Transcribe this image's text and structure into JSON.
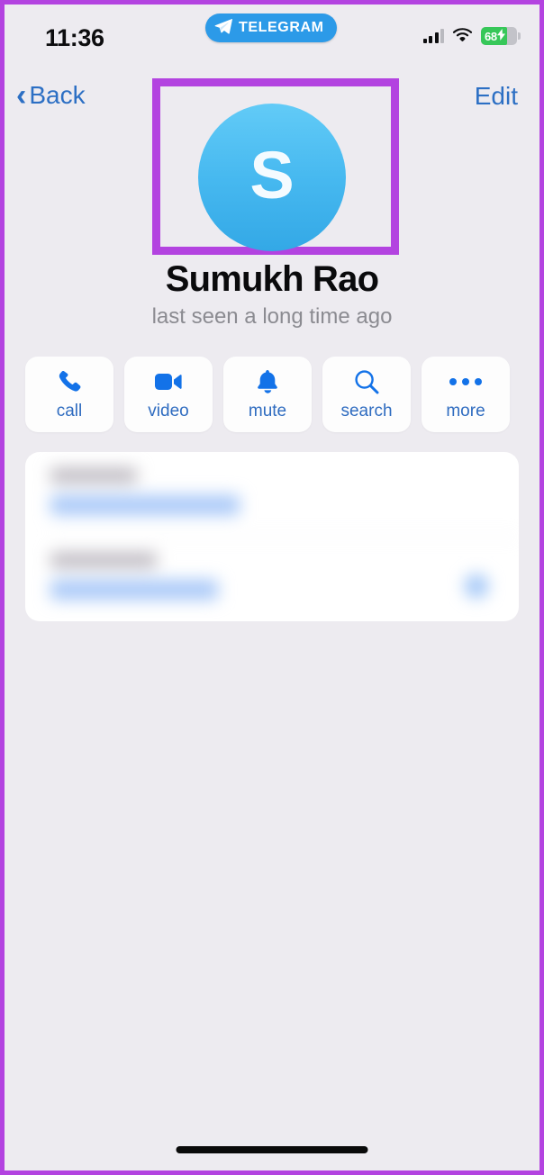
{
  "status_bar": {
    "time": "11:36",
    "app_pill": {
      "label": "TELEGRAM",
      "icon": "telegram-paper-plane-icon",
      "color": "#2c9ae8"
    },
    "cellular_icon": "cellular-signal-icon",
    "wifi_icon": "wifi-icon",
    "battery": {
      "percent": "68",
      "charging_icon": "lightning-bolt-icon",
      "color": "#37c759"
    }
  },
  "nav_bar": {
    "back_label": "Back",
    "back_icon": "chevron-left-icon",
    "edit_label": "Edit",
    "accent_color": "#2c6fc4"
  },
  "profile": {
    "avatar_initial": "S",
    "avatar_color_top": "#62cbf7",
    "avatar_color_bottom": "#33a8e6",
    "name": "Sumukh Rao",
    "status": "last seen a long time ago",
    "highlight_color": "#b343e0"
  },
  "actions": [
    {
      "label": "call",
      "icon": "phone-icon"
    },
    {
      "label": "video",
      "icon": "video-camera-icon"
    },
    {
      "label": "mute",
      "icon": "bell-icon"
    },
    {
      "label": "search",
      "icon": "magnifier-icon"
    },
    {
      "label": "more",
      "icon": "ellipsis-icon"
    }
  ],
  "info_card": {
    "blurred": true,
    "rows": [
      {
        "label_width": 96,
        "value_width": 210,
        "has_trailing_dot": false
      },
      {
        "label_width": 118,
        "value_width": 186,
        "has_trailing_dot": true
      }
    ]
  },
  "home_indicator": {
    "name": "home-indicator"
  }
}
